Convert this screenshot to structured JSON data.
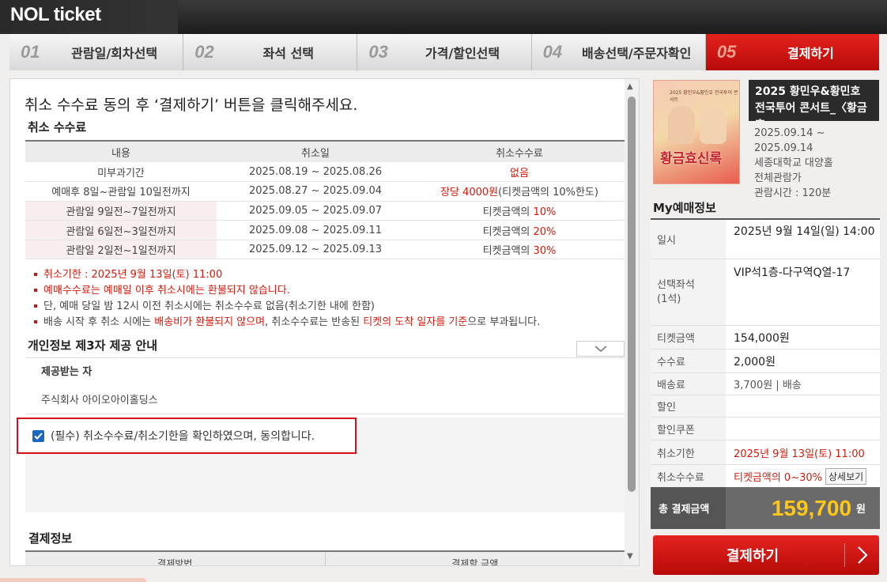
{
  "header": {
    "logo": "NOL ticket"
  },
  "steps": [
    {
      "num": "01",
      "label": "관람일/회차선택"
    },
    {
      "num": "02",
      "label": "좌석 선택"
    },
    {
      "num": "03",
      "label": "가격/할인선택"
    },
    {
      "num": "04",
      "label": "배송선택/주문자확인"
    },
    {
      "num": "05",
      "label": "결제하기"
    }
  ],
  "main": {
    "title": "취소 수수료 동의 후 ‘결제하기’ 버튼을 클릭해주세요.",
    "fee_section_title": "취소 수수료",
    "fee_table": {
      "headers": [
        "내용",
        "취소일",
        "취소수수료"
      ],
      "rows": [
        {
          "content": "미부과기간",
          "date": "2025.08.19 ~ 2025.08.26",
          "fee_red": "없음",
          "fee_rest": ""
        },
        {
          "content": "예매후 8일~관람일 10일전까지",
          "date": "2025.08.27 ~ 2025.09.04",
          "fee_red": "장당 4000원",
          "fee_rest": "(티켓금액의 10%한도)"
        },
        {
          "content": "관람일 9일전~7일전까지",
          "date": "2025.09.05 ~ 2025.09.07",
          "fee_prefix": "티켓금액의 ",
          "fee_red": "10%"
        },
        {
          "content": "관람일 6일전~3일전까지",
          "date": "2025.09.08 ~ 2025.09.11",
          "fee_prefix": "티켓금액의 ",
          "fee_red": "20%"
        },
        {
          "content": "관람일 2일전~1일전까지",
          "date": "2025.09.12 ~ 2025.09.13",
          "fee_prefix": "티켓금액의 ",
          "fee_red": "30%"
        }
      ]
    },
    "notes": {
      "n1": "취소기한 : 2025년 9월 13일(토) 11:00",
      "n2": "예매수수료는 예매일 이후 취소시에는 환불되지 않습니다.",
      "n3": "단, 예매 당일 밤 12시 이전 취소시에는 취소수수료 없음(취소기한 내에 한함)",
      "n4a": "배송 시작 후 취소 시에는 ",
      "n4b": "배송비가 환불되지 않으며",
      "n4c": ", 취소수수료는 반송된 ",
      "n4d": "티켓의 도착 일자를 기준",
      "n4e": "으로 부과됩니다."
    },
    "privacy_title": "개인정보 제3자 제공 안내",
    "provider_label": "제공받는 자",
    "provider_name": "주식회사 아이오아이홀딩스",
    "agree_text": "(필수) 취소수수료/취소기한을 확인하였으며, 동의합니다.",
    "payment_title": "결제정보",
    "payment_headers": [
      "결제방법",
      "결제할 금액"
    ]
  },
  "show": {
    "title": "2025 황민우&황민호 전국투어 콘서트_〈황금효",
    "poster_text": "황금효신록",
    "poster_small": "2025 황민우&황민호 전국투어 콘서트",
    "dates": "2025.09.14 ~",
    "date_end": "2025.09.14",
    "venue": "세종대학교 대양홀",
    "rating": "전체관람가",
    "runtime": "관람시간 : 120분"
  },
  "my": {
    "title": "My예매정보",
    "datetime_label": "일시",
    "datetime": "2025년 9월 14일(일) 14:00",
    "seat_label": "선택좌석\n(1석)",
    "seat": "VIP석1층-다구역Q열-17",
    "ticket_label": "티켓금액",
    "ticket": "154,000원",
    "fee_label": "수수료",
    "fee": "2,000원",
    "delivery_label": "배송료",
    "delivery": "3,700원 | 배송",
    "discount_label": "할인",
    "discount": "",
    "coupon_label": "할인쿠폰",
    "coupon": "",
    "deadline_label": "취소기한",
    "deadline": "2025년 9월 13일(토) 11:00",
    "cancel_fee_label": "취소수수료",
    "cancel_fee": "티켓금액의 0~30%",
    "detail_label": "상세보기",
    "total_label": "총 결제금액",
    "total": "159,700",
    "total_unit": "원",
    "pay_button": "결제하기"
  }
}
